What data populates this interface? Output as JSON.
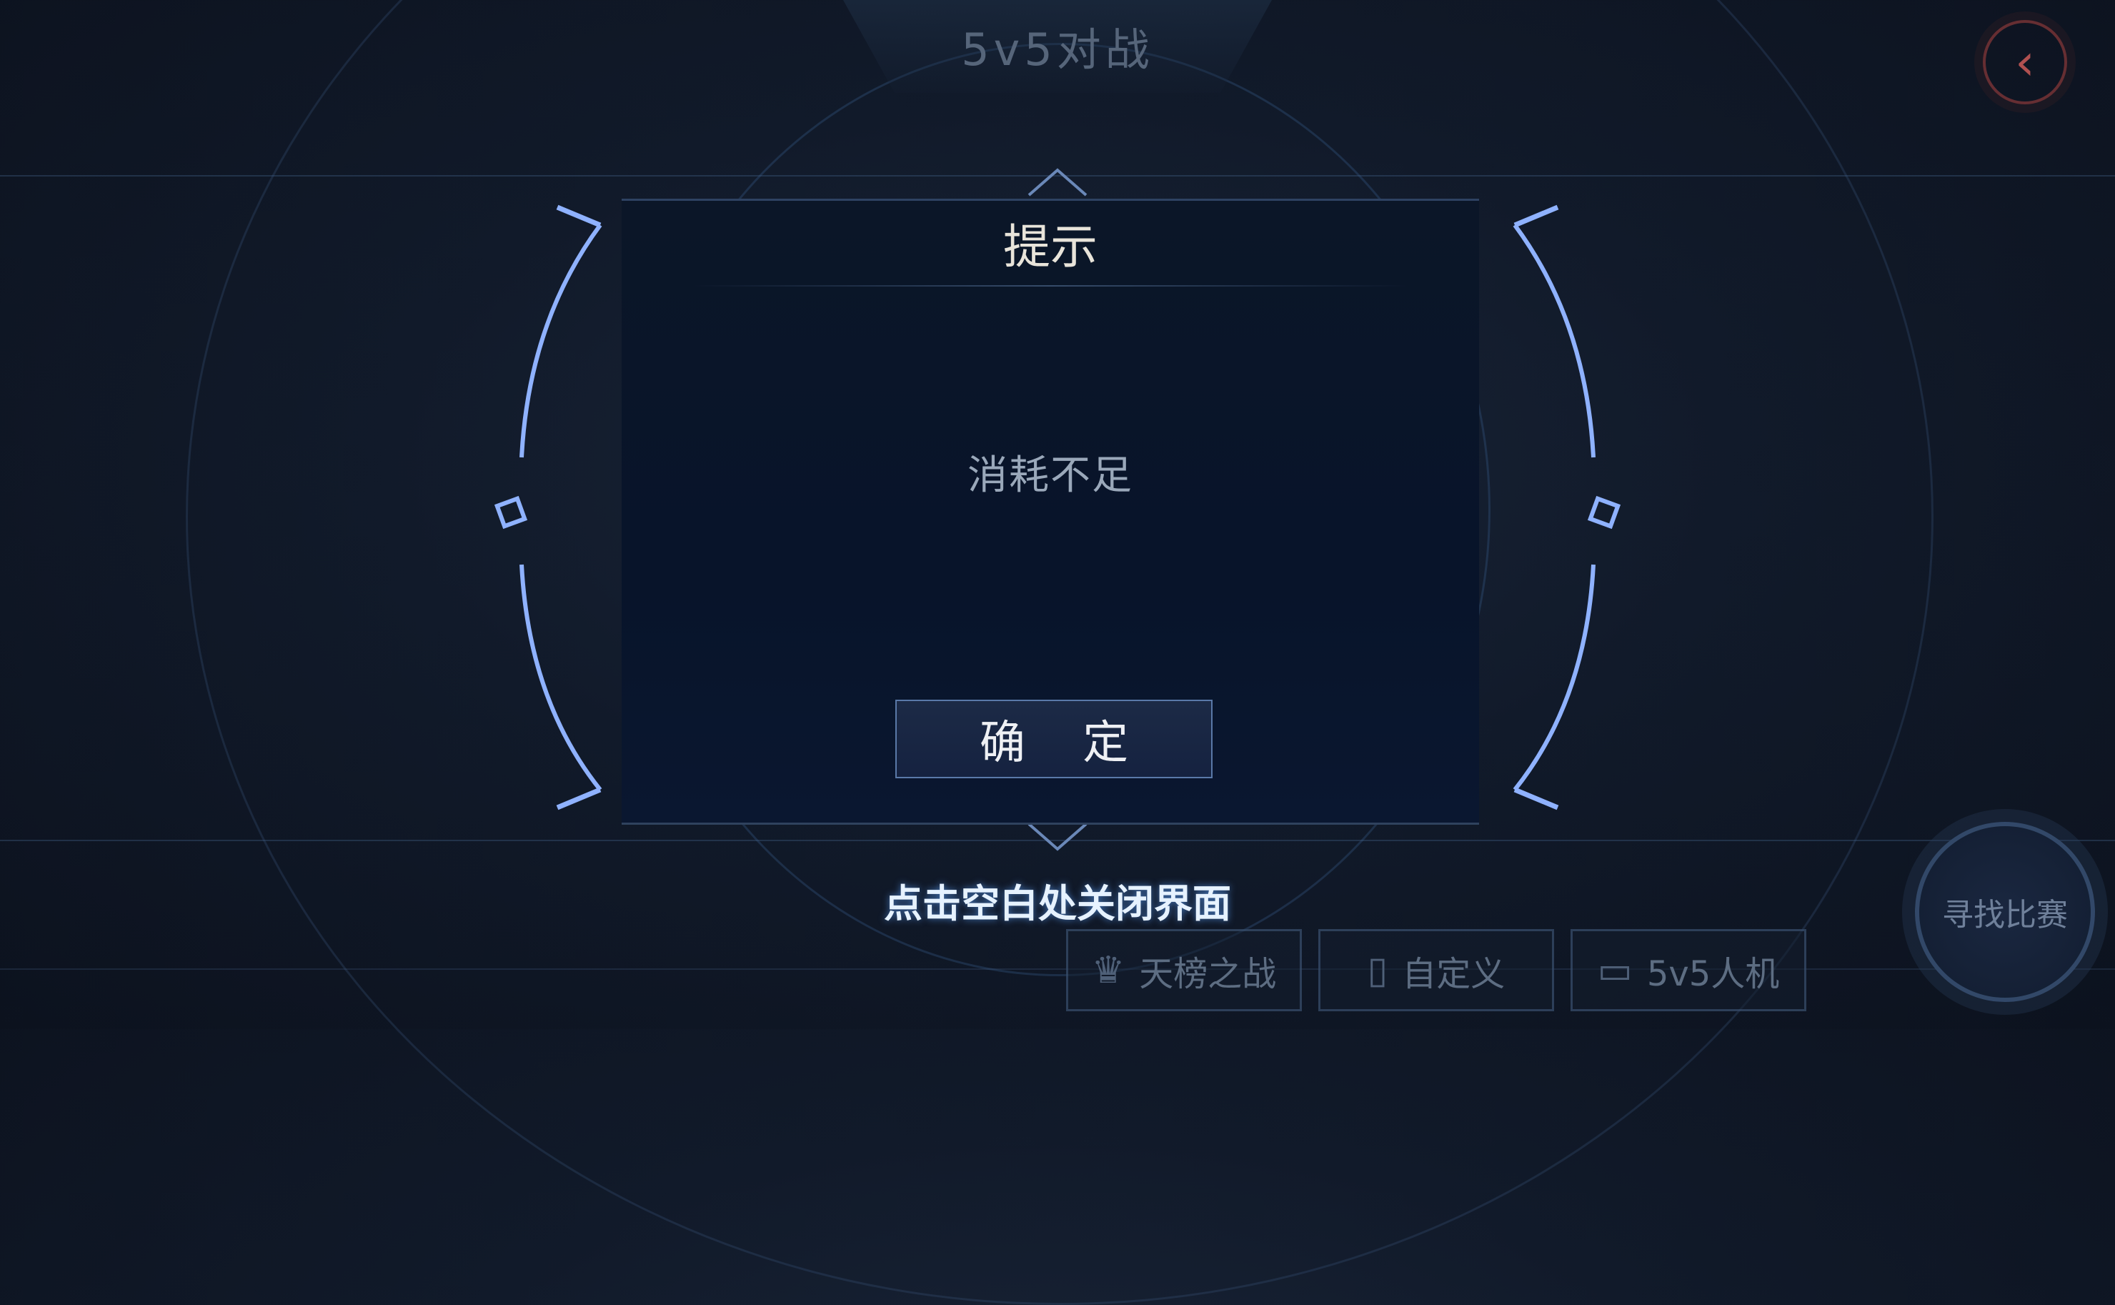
{
  "header": {
    "mode_title": "5v5对战"
  },
  "back_button": {
    "icon": "chevron-left-icon"
  },
  "dialog": {
    "title": "提示",
    "message": "消耗不足",
    "confirm_label": "确 定"
  },
  "close_hint": "点击空白处关闭界面",
  "bottom_tabs": [
    {
      "label": "天榜之战",
      "icon": "crown-icon"
    },
    {
      "label": "自定义",
      "icon": "door-icon"
    },
    {
      "label": "5v5人机",
      "icon": "monitor-icon"
    }
  ],
  "find_match_label": "寻找比赛",
  "colors": {
    "accent_blue": "#8fb2ff",
    "dialog_bg": "#08142a",
    "hint_text": "#e6f2ff",
    "back_red": "#b05050"
  }
}
